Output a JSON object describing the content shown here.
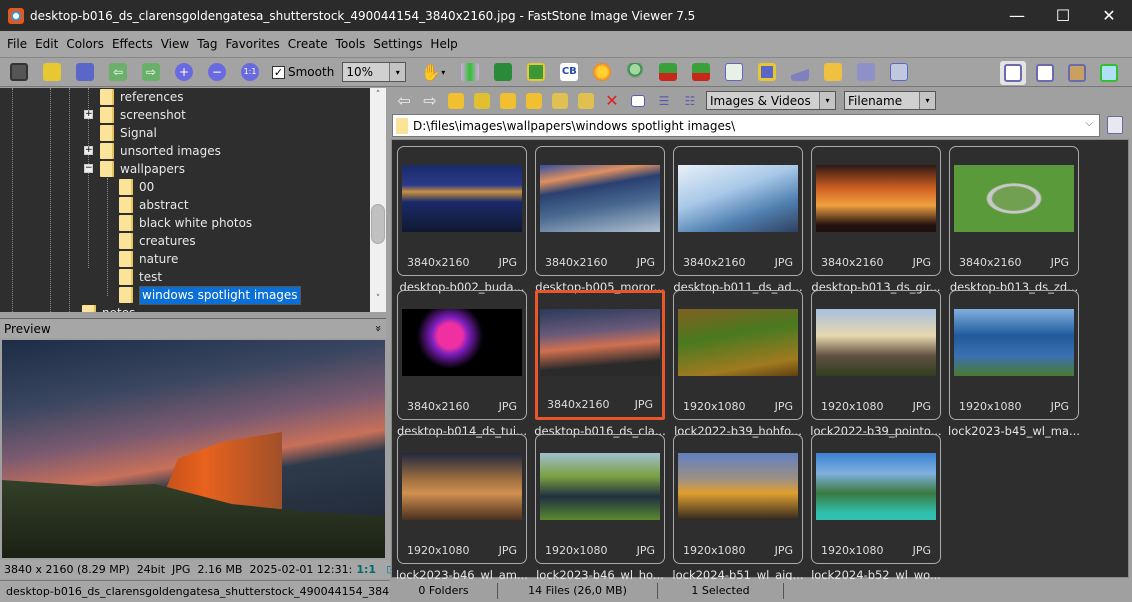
{
  "window": {
    "title": "desktop-b016_ds_clarensgoldengatesa_shutterstock_490044154_3840x2160.jpg  -  FastStone Image Viewer 7.5",
    "minimize": "—",
    "maximize": "☐",
    "close": "✕"
  },
  "menu": [
    "File",
    "Edit",
    "Colors",
    "Effects",
    "View",
    "Tag",
    "Favorites",
    "Create",
    "Tools",
    "Settings",
    "Help"
  ],
  "toolbar": {
    "smooth_label": "Smooth",
    "smooth_checked": "✓",
    "zoom_value": "10%",
    "dropdown_arrow": "▾",
    "hand_arrow": "▾"
  },
  "tree": {
    "items": [
      {
        "label": "references"
      },
      {
        "label": "screenshot",
        "expander": "+"
      },
      {
        "label": "Signal"
      },
      {
        "label": "unsorted images",
        "expander": "+"
      },
      {
        "label": "wallpapers",
        "expander": "−"
      },
      {
        "label": "00"
      },
      {
        "label": "abstract"
      },
      {
        "label": "black white photos"
      },
      {
        "label": "creatures"
      },
      {
        "label": "nature"
      },
      {
        "label": "test"
      },
      {
        "label": "windows spotlight images",
        "selected": true
      },
      {
        "label": "notes"
      }
    ],
    "scroll_up": "˄",
    "scroll_down": "˅"
  },
  "preview": {
    "label": "Preview",
    "collapse": "»"
  },
  "info": {
    "dimensions": "3840 x 2160 (8.29 MP)",
    "bitdepth": "24bit",
    "format": "JPG",
    "size": "2.16 MB",
    "date": "2025-02-01 12:31:",
    "ratio": "1:1"
  },
  "filename_status": "desktop-b016_ds_clarensgoldengatesa_shutterstock_490044154_3840x2160.jpg",
  "filter": {
    "type": "Images & Videos",
    "sort": "Filename"
  },
  "path": "D:\\files\\images\\wallpapers\\windows spotlight images\\",
  "thumbnails": [
    {
      "name": "desktop-b002_buda...",
      "dims": "3840x2160",
      "fmt": "JPG"
    },
    {
      "name": "desktop-b005_moror...",
      "dims": "3840x2160",
      "fmt": "JPG"
    },
    {
      "name": "desktop-b011_ds_ad...",
      "dims": "3840x2160",
      "fmt": "JPG"
    },
    {
      "name": "desktop-b013_ds_gir...",
      "dims": "3840x2160",
      "fmt": "JPG"
    },
    {
      "name": "desktop-b013_ds_zd...",
      "dims": "3840x2160",
      "fmt": "JPG"
    },
    {
      "name": "desktop-b014_ds_tui...",
      "dims": "3840x2160",
      "fmt": "JPG"
    },
    {
      "name": "desktop-b016_ds_cla...",
      "dims": "3840x2160",
      "fmt": "JPG",
      "selected": true
    },
    {
      "name": "lock2022-b39_hohfo...",
      "dims": "1920x1080",
      "fmt": "JPG"
    },
    {
      "name": "lock2022-b39_pointo...",
      "dims": "1920x1080",
      "fmt": "JPG"
    },
    {
      "name": "lock2023-b45_wl_ma...",
      "dims": "1920x1080",
      "fmt": "JPG"
    },
    {
      "name": "lock2023-b46_wl_am...",
      "dims": "1920x1080",
      "fmt": "JPG"
    },
    {
      "name": "lock2023-b46_wl_ho...",
      "dims": "1920x1080",
      "fmt": "JPG"
    },
    {
      "name": "lock2024-b51_wl_aig...",
      "dims": "1920x1080",
      "fmt": "JPG"
    },
    {
      "name": "lock2024-b52_wl_wo...",
      "dims": "1920x1080",
      "fmt": "JPG"
    }
  ],
  "status": {
    "folders": "0 Folders",
    "files": "14 Files (26,0 MB)",
    "selected": "1 Selected"
  },
  "colors": {
    "selection_border": "#e8562a",
    "tree_selection": "#0a70d8",
    "panel_bg": "#2e2e2e"
  }
}
